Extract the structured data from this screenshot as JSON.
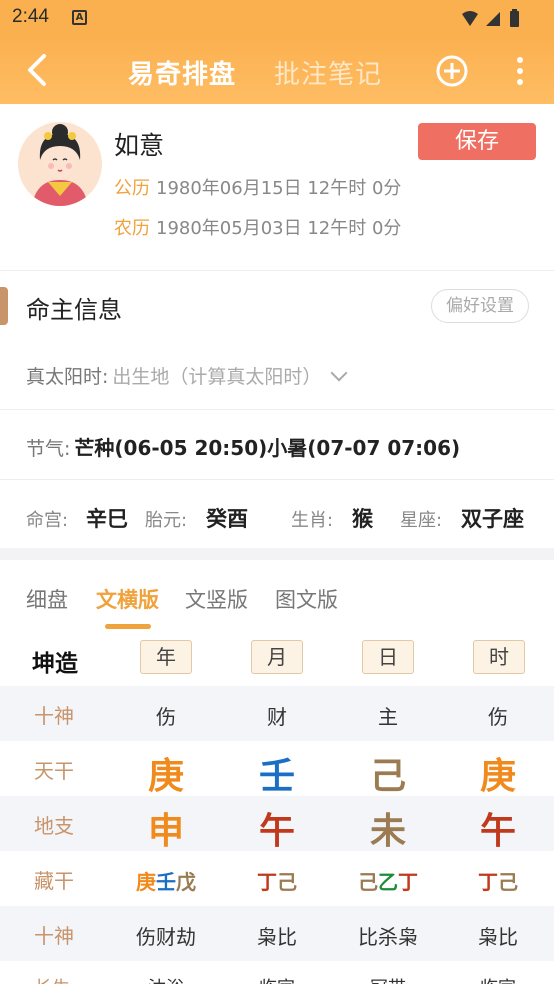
{
  "status": {
    "time": "2:44",
    "a_badge": "A"
  },
  "header": {
    "title": "易奇排盘",
    "notes_tab": "批注笔记"
  },
  "profile": {
    "name": "如意",
    "save_label": "保存",
    "solar_tag": "公历",
    "solar_value": "1980年06月15日 12午时 0分",
    "lunar_tag": "农历",
    "lunar_value": "1980年05月03日 12午时 0分"
  },
  "section": {
    "title": "命主信息",
    "pref_label": "偏好设置"
  },
  "solar_time": {
    "label": "真太阳时:",
    "value": "出生地（计算真太阳时）"
  },
  "jieqi": {
    "label": "节气:",
    "value": "芒种(06-05 20:50)小暑(07-07 07:06)"
  },
  "info": {
    "minggong_label": "命宫:",
    "minggong": "辛巳",
    "taiyuan_label": "胎元:",
    "taiyuan": "癸酉",
    "shengxiao_label": "生肖:",
    "shengxiao": "猴",
    "xingzuo_label": "星座:",
    "xingzuo": "双子座"
  },
  "subtabs": [
    "细盘",
    "文横版",
    "文竖版",
    "图文版"
  ],
  "active_subtab": "文横版",
  "grid": {
    "title": "坤造",
    "pillars": [
      "年",
      "月",
      "日",
      "时"
    ],
    "rows": [
      {
        "label": "十神",
        "cells": [
          "伤",
          "财",
          "主",
          "伤"
        ]
      },
      {
        "label": "天干",
        "cells": [
          "庚",
          "壬",
          "己",
          "庚"
        ]
      },
      {
        "label": "地支",
        "cells": [
          "申",
          "午",
          "未",
          "午"
        ]
      },
      {
        "label": "藏干",
        "cells": [
          [
            "庚",
            "壬",
            "戊"
          ],
          [
            "丁",
            "己"
          ],
          [
            "己",
            "乙",
            "丁"
          ],
          [
            "丁",
            "己"
          ]
        ]
      },
      {
        "label": "十神",
        "cells": [
          "伤财劫",
          "枭比",
          "比杀枭",
          "枭比"
        ]
      }
    ],
    "last_row": {
      "label": "长生",
      "cells": [
        "沐浴",
        "临官",
        "冠带",
        "临官"
      ]
    }
  },
  "colors": {
    "accent": "#f0a23c",
    "earth": "#f08a1c",
    "water": "#1a6fc4",
    "fire": "#c0391c",
    "wood": "#1e8a3a",
    "save": "#ef6f63",
    "label": "#c8946a"
  }
}
